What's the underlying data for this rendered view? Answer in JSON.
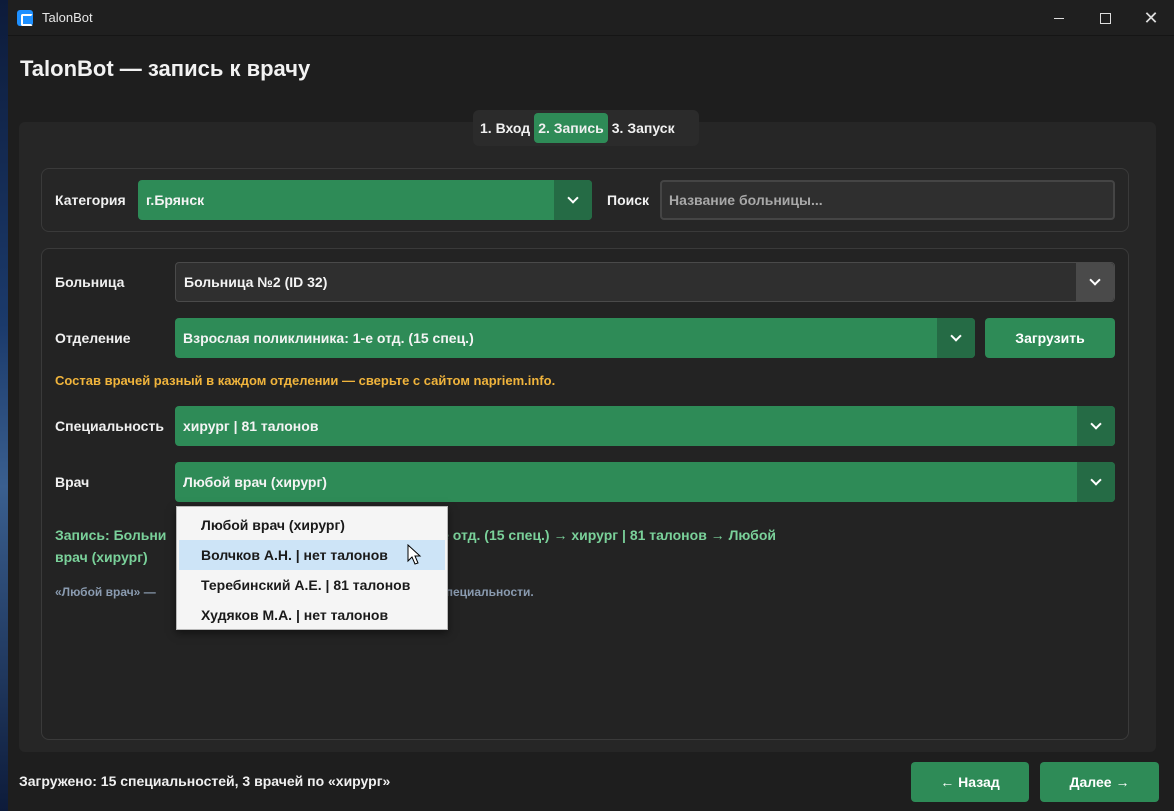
{
  "window": {
    "title": "TalonBot"
  },
  "page": {
    "title": "TalonBot — запись к врачу"
  },
  "tabs": [
    {
      "label": "1. Вход",
      "active": false
    },
    {
      "label": "2. Запись",
      "active": true
    },
    {
      "label": "3. Запуск",
      "active": false
    }
  ],
  "category": {
    "label": "Категория",
    "value": "г.Брянск"
  },
  "search": {
    "label": "Поиск",
    "placeholder": "Название больницы..."
  },
  "hospital": {
    "label": "Больница",
    "value": "Больница №2 (ID 32)"
  },
  "department": {
    "label": "Отделение",
    "value": "Взрослая поликлиника: 1-е отд. (15 спец.)",
    "load_button": "Загрузить"
  },
  "warning": "Состав врачей разный в каждом отделении — сверьте с сайтом napriem.info.",
  "specialty": {
    "label": "Специальность",
    "value": "хирург | 81 талонов"
  },
  "doctor": {
    "label": "Врач",
    "value": "Любой врач (хирург)",
    "options": [
      "Любой врач (хирург)",
      "Волчков А.Н. | нет талонов",
      "Теребинский А.Е. | 81 талонов",
      "Худяков М.А. | нет талонов"
    ],
    "hovered_index": 1
  },
  "summary": {
    "line1_left": "Запись: Больни",
    "line1_right": "-е отд. (15 спец.) → хирург | 81 талонов → Любой",
    "line2": "врач (хирург)"
  },
  "hint": {
    "left": "«Любой врач» —",
    "right": "пециальности."
  },
  "footer": {
    "status": "Загружено: 15 специальностей, 3 врачей по «хирург»",
    "back_button": "← Назад",
    "next_button": "Далее →"
  },
  "colors": {
    "accent": "#2e8b57",
    "warning": "#f0b43c",
    "summary": "#7ad19a",
    "hint": "#8a9bb0"
  }
}
